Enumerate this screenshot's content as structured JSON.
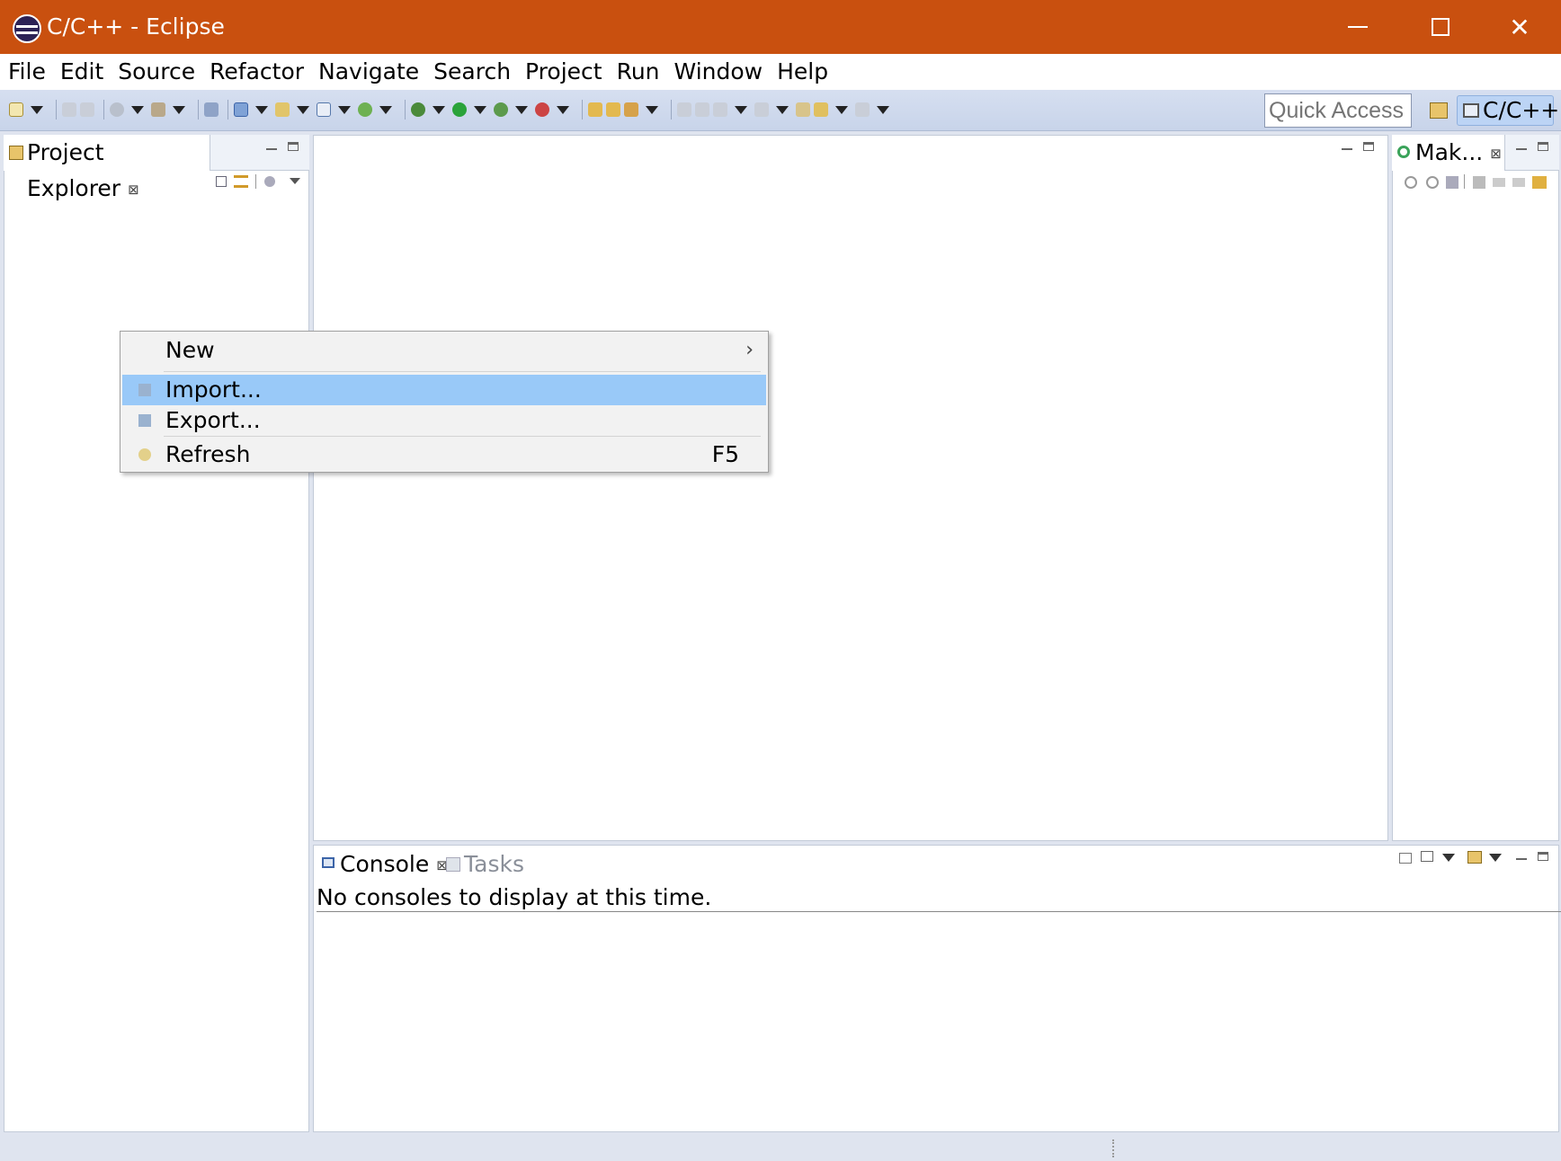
{
  "window": {
    "title": "C/C++ - Eclipse",
    "minimize": "Minimize",
    "maximize": "Maximize",
    "close": "✕"
  },
  "menubar": {
    "items": [
      "File",
      "Edit",
      "Source",
      "Refactor",
      "Navigate",
      "Search",
      "Project",
      "Run",
      "Window",
      "Help"
    ]
  },
  "toolbar": {
    "quick_access_placeholder": "Quick Access",
    "perspective_label": "C/C++"
  },
  "project_explorer": {
    "tab_label": "Project Explorer"
  },
  "make_view": {
    "tab_label": "Mak..."
  },
  "context_menu": {
    "items": [
      {
        "label": "New",
        "shortcut": "",
        "submenu": true
      },
      {
        "label": "Import...",
        "shortcut": ""
      },
      {
        "label": "Export...",
        "shortcut": ""
      },
      {
        "label": "Refresh",
        "shortcut": "F5"
      }
    ]
  },
  "console": {
    "tab_label": "Console",
    "tasks_tab_label": "Tasks",
    "message": "No consoles to display at this time."
  },
  "colors": {
    "titlebar": "#c9500f",
    "highlight": "#99c9f8",
    "toolbar": "#d0daee"
  }
}
